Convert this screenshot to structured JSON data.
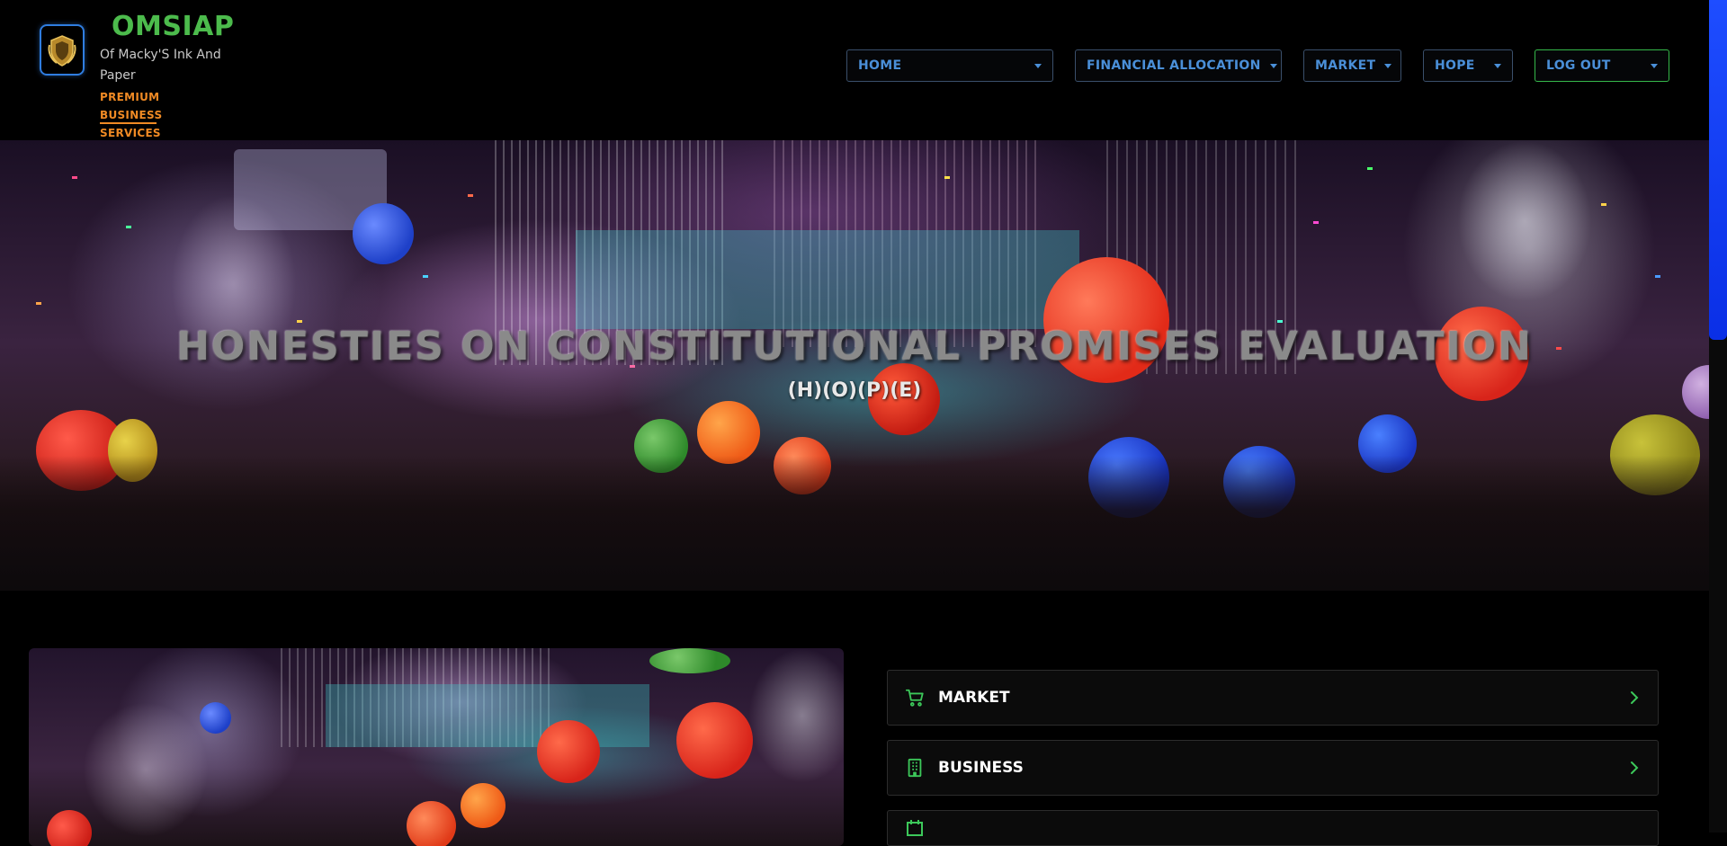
{
  "brand": {
    "name": "OMSIAP",
    "subtitle": "Of Macky'S Ink And Paper",
    "tagline": "PREMIUM BUSINESS SERVICES",
    "logo_icon": "shield-crest-icon"
  },
  "nav": {
    "items": [
      {
        "label": "HOME"
      },
      {
        "label": "FINANCIAL ALLOCATION"
      },
      {
        "label": "MARKET"
      },
      {
        "label": "HOPE"
      },
      {
        "label": "LOG OUT"
      }
    ]
  },
  "hero": {
    "title": "HONESTIES ON CONSTITUTIONAL PROMISES EVALUATION",
    "subtitle": "(H)(O)(P)(E)"
  },
  "menu": {
    "items": [
      {
        "label": "MARKET",
        "icon": "cart-icon"
      },
      {
        "label": "BUSINESS",
        "icon": "building-icon"
      }
    ]
  },
  "colors": {
    "brand_green": "#4cbb4c",
    "accent_orange": "#f08a24",
    "nav_blue": "#4a8fd8",
    "scrollbar_blue": "#1e4dff"
  }
}
